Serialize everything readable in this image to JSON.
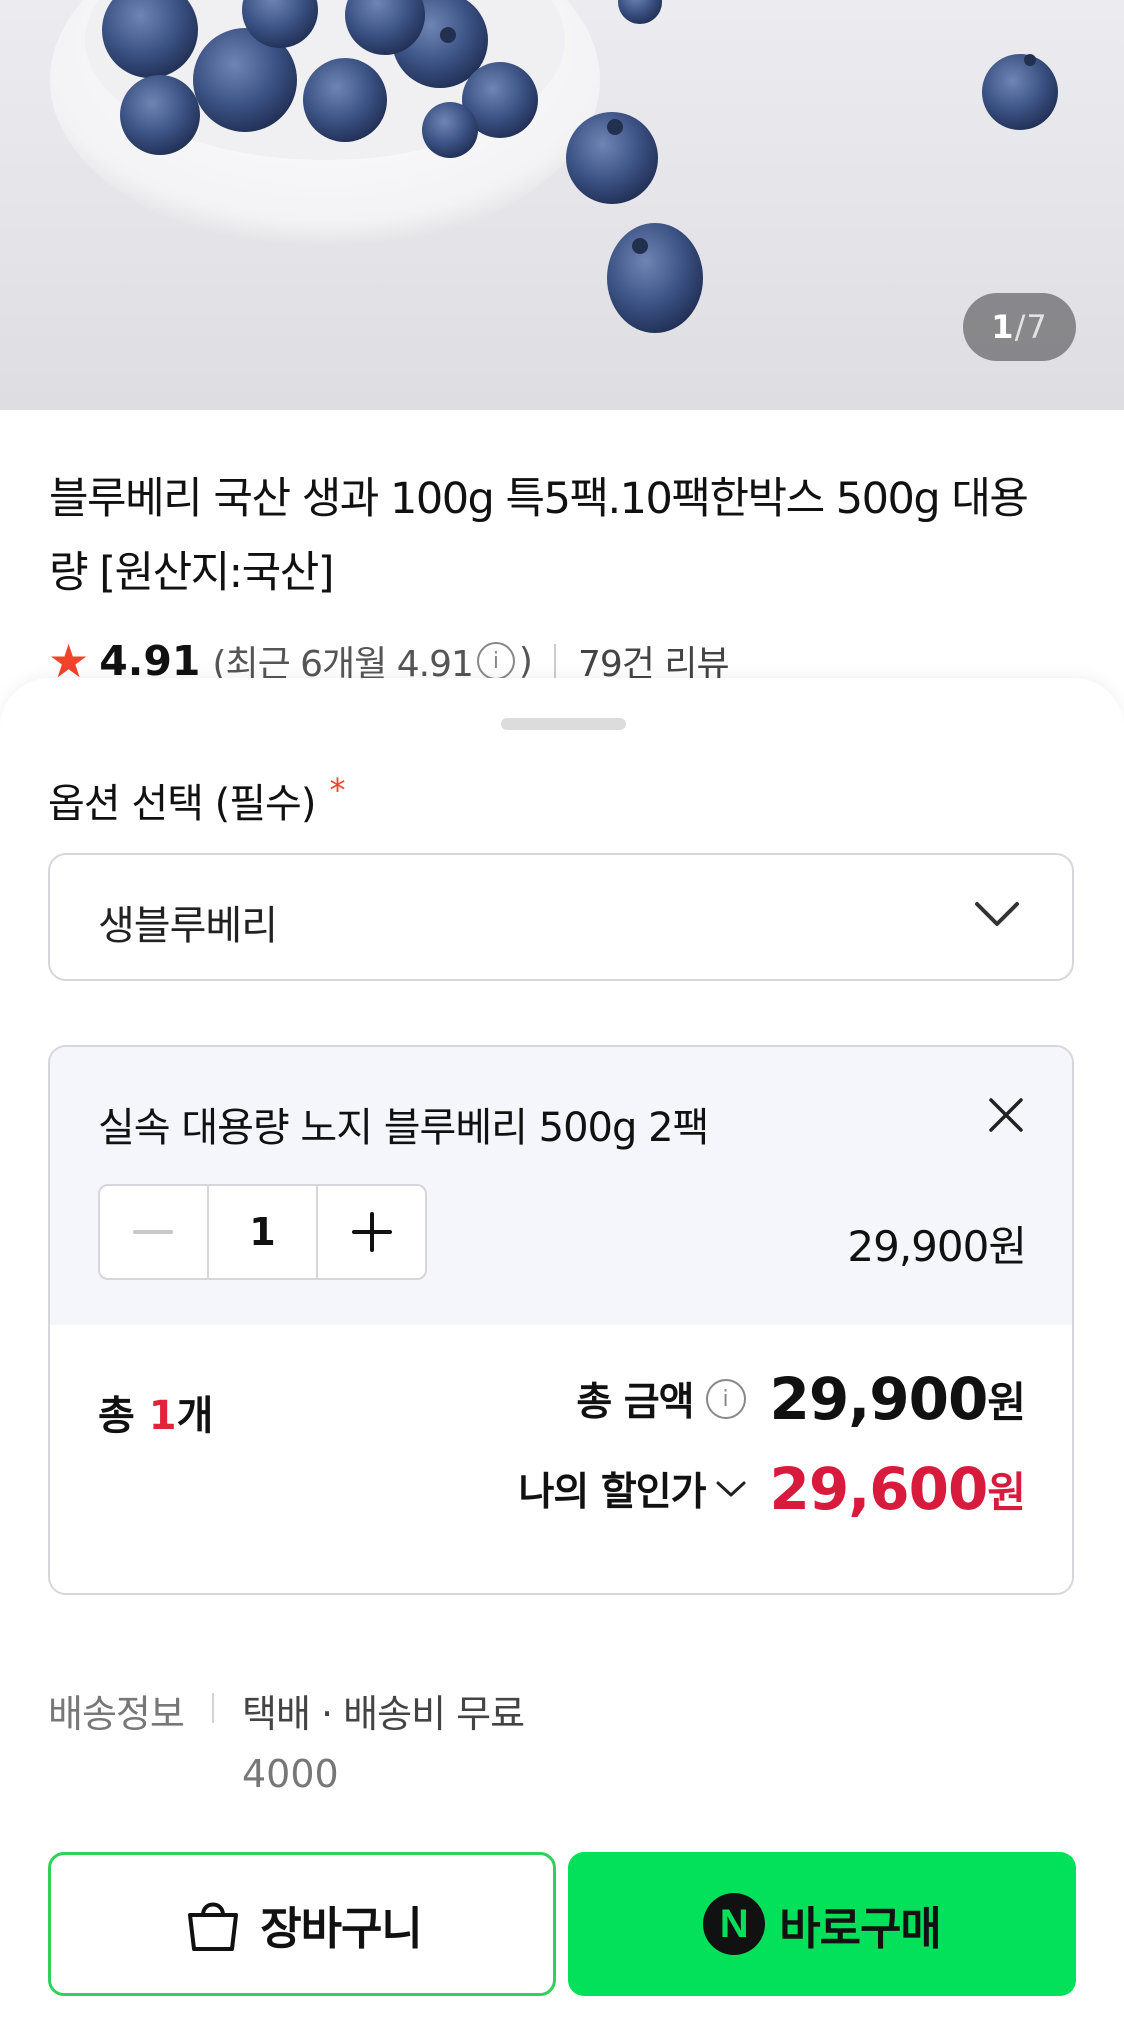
{
  "gallery": {
    "current": "1",
    "separator": "/",
    "total": "7"
  },
  "product": {
    "title": "블루베리 국산 생과 100g 특5팩.10팩한박스 500g 대용량 [원산지:국산]",
    "rating": {
      "star_icon": "star-icon",
      "score": "4.91",
      "recent_text": "(최근 6개월 4.91",
      "recent_close": ")",
      "info_icon": "info-icon",
      "review_link": "79건 리뷰"
    }
  },
  "option_sheet": {
    "label": "옵션 선택 (필수)",
    "required_mark": "*",
    "select": {
      "value": "생블루베리",
      "icon": "chevron-down-icon"
    },
    "selected_item": {
      "name": "실속 대용량 노지 블루베리 500g 2팩",
      "quantity": "1",
      "price": "29,900원",
      "remove_icon": "close-icon"
    },
    "summary": {
      "count_prefix": "총 ",
      "count": "1",
      "count_suffix": "개",
      "total_label": "총 금액",
      "total_amount": "29,900",
      "won": "원",
      "discount_label": "나의 할인가",
      "discount_amount": "29,600"
    },
    "shipping": {
      "label": "배송정보",
      "method": "택배 · 배송비 무료",
      "fee": "4000"
    },
    "buttons": {
      "cart_label": "장바구니",
      "buy_label": "바로구매",
      "buy_logo": "N"
    }
  },
  "colors": {
    "accent_red": "#d81b3c",
    "buy_green": "#03e05a",
    "cart_border": "#2fd05b",
    "star": "#f0442c"
  }
}
